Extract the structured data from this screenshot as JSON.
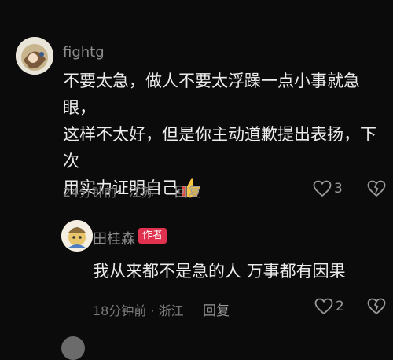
{
  "comments": [
    {
      "username": "fightg",
      "content_lines": [
        "不要太急，做人不要太浮躁一点小事就急眼，",
        "这样不太好，但是你主动道歉提出表扬，下次",
        "用实力证明自己"
      ],
      "emoji": "👍",
      "meta": "24分钟前 · 江苏",
      "reply_label": "回复",
      "likes": "3"
    },
    {
      "username": "田桂森",
      "author_badge": "作者",
      "content": "我从来都不是急的人 万事都有因果",
      "meta": "18分钟前 · 浙江",
      "reply_label": "回复",
      "likes": "2"
    }
  ],
  "icons": {
    "like": "heart-outline-icon",
    "dislike": "broken-heart-icon",
    "thumbs_up": "thumbs-up-emoji"
  },
  "colors": {
    "background": "#0b0b0b",
    "author_badge": "#e0314e"
  }
}
